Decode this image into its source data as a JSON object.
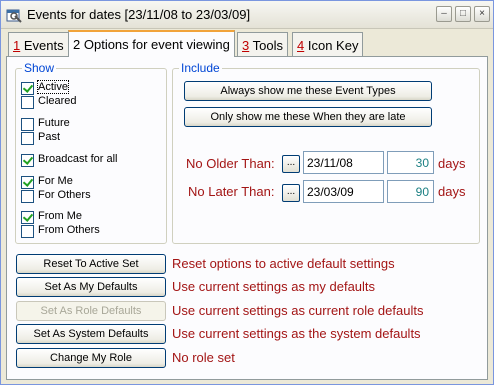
{
  "window": {
    "title": "Events for dates [23/11/08 to 23/03/09]",
    "controls": {
      "minimize": "–",
      "maximize": "□",
      "close": "×"
    }
  },
  "tabs": [
    {
      "num": "1",
      "label": "Events"
    },
    {
      "num": "2",
      "label": "Options for event viewing"
    },
    {
      "num": "3",
      "label": "Tools"
    },
    {
      "num": "4",
      "label": "Icon Key"
    }
  ],
  "show_group": {
    "title": "Show",
    "items": [
      {
        "label": "Active",
        "checked": true
      },
      {
        "label": "Cleared",
        "checked": false
      },
      {
        "label": "Future",
        "checked": false
      },
      {
        "label": "Past",
        "checked": false
      },
      {
        "label": "Broadcast for all",
        "checked": true
      },
      {
        "label": "For Me",
        "checked": true
      },
      {
        "label": "For Others",
        "checked": false
      },
      {
        "label": "From Me",
        "checked": true
      },
      {
        "label": "From Others",
        "checked": false
      }
    ]
  },
  "include_group": {
    "title": "Include",
    "always_button": "Always show me these Event Types",
    "only_button": "Only show me these When they are late",
    "no_older_label": "No Older Than:",
    "no_later_label": "No Later Than:",
    "ellipsis": "...",
    "no_older_date": "23/11/08",
    "no_later_date": "23/03/09",
    "no_older_days": "30",
    "no_later_days": "90",
    "days_label": "days"
  },
  "actions": [
    {
      "button": "Reset To Active Set",
      "description": "Reset options to active default settings",
      "enabled": true
    },
    {
      "button": "Set As My Defaults",
      "description": "Use current settings as my defaults",
      "enabled": true
    },
    {
      "button": "Set As Role Defaults",
      "description": "Use current settings as current role defaults",
      "enabled": false
    },
    {
      "button": "Set As System Defaults",
      "description": "Use current settings as the system defaults",
      "enabled": true
    },
    {
      "button": "Change My Role",
      "description": "No role set",
      "enabled": true
    }
  ]
}
